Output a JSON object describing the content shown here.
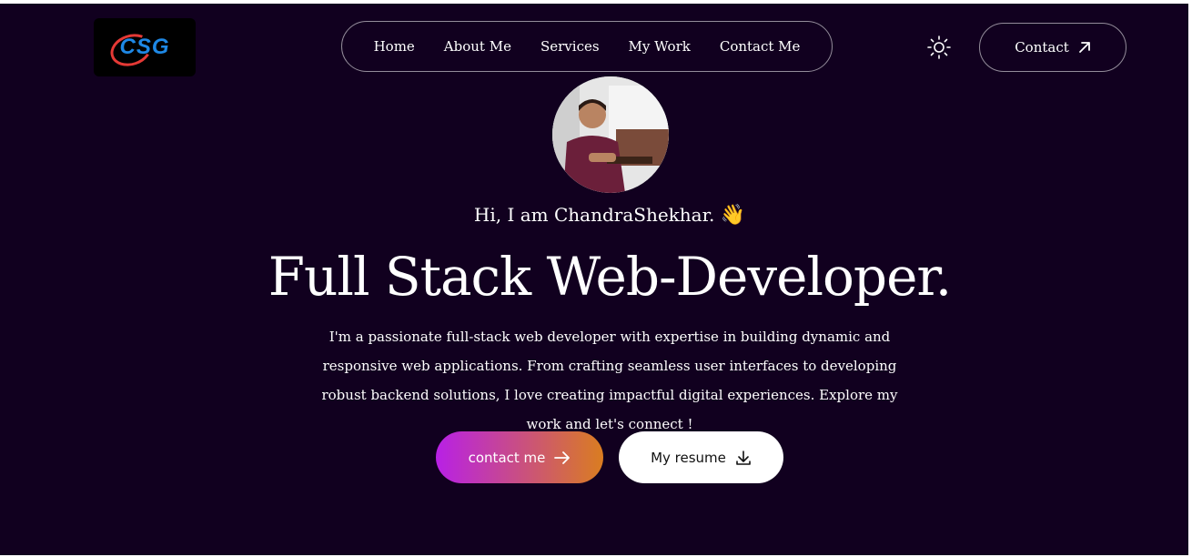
{
  "logo": {
    "text": "CSG"
  },
  "nav": {
    "items": [
      {
        "label": "Home"
      },
      {
        "label": "About Me"
      },
      {
        "label": "Services"
      },
      {
        "label": "My Work"
      },
      {
        "label": "Contact Me"
      }
    ]
  },
  "header": {
    "theme_icon": "sun-icon",
    "contact_label": "Contact",
    "contact_icon": "arrow-up-right-icon"
  },
  "hero": {
    "greeting": "Hi, I am ChandraShekhar.",
    "wave_emoji": "👋",
    "headline": "Full Stack Web-Developer.",
    "description": "I'm a passionate full-stack web developer with expertise in building dynamic and responsive web applications. From crafting seamless user interfaces to developing robust backend solutions, I love creating impactful digital experiences. Explore my work and let's connect !",
    "primary_button": "contact me",
    "secondary_button": "My resume"
  },
  "colors": {
    "background": "#11001f",
    "gradient_start": "#b820e6",
    "gradient_end": "#da7d20",
    "logo_blue": "#1e88e5",
    "logo_red": "#e53935"
  }
}
